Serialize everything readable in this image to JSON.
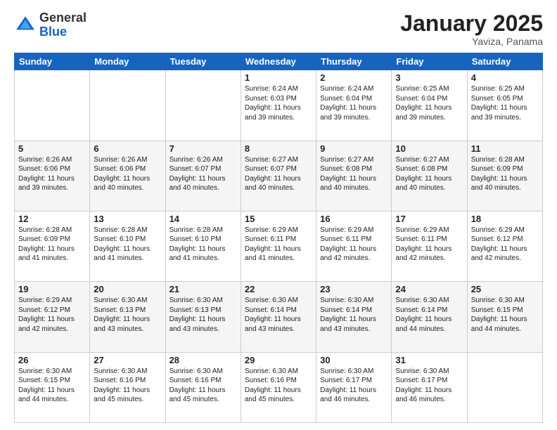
{
  "logo": {
    "general": "General",
    "blue": "Blue"
  },
  "header": {
    "month": "January 2025",
    "location": "Yaviza, Panama"
  },
  "days_of_week": [
    "Sunday",
    "Monday",
    "Tuesday",
    "Wednesday",
    "Thursday",
    "Friday",
    "Saturday"
  ],
  "weeks": [
    [
      {
        "day": "",
        "info": ""
      },
      {
        "day": "",
        "info": ""
      },
      {
        "day": "",
        "info": ""
      },
      {
        "day": "1",
        "info": "Sunrise: 6:24 AM\nSunset: 6:03 PM\nDaylight: 11 hours and 39 minutes."
      },
      {
        "day": "2",
        "info": "Sunrise: 6:24 AM\nSunset: 6:04 PM\nDaylight: 11 hours and 39 minutes."
      },
      {
        "day": "3",
        "info": "Sunrise: 6:25 AM\nSunset: 6:04 PM\nDaylight: 11 hours and 39 minutes."
      },
      {
        "day": "4",
        "info": "Sunrise: 6:25 AM\nSunset: 6:05 PM\nDaylight: 11 hours and 39 minutes."
      }
    ],
    [
      {
        "day": "5",
        "info": "Sunrise: 6:26 AM\nSunset: 6:06 PM\nDaylight: 11 hours and 39 minutes."
      },
      {
        "day": "6",
        "info": "Sunrise: 6:26 AM\nSunset: 6:06 PM\nDaylight: 11 hours and 40 minutes."
      },
      {
        "day": "7",
        "info": "Sunrise: 6:26 AM\nSunset: 6:07 PM\nDaylight: 11 hours and 40 minutes."
      },
      {
        "day": "8",
        "info": "Sunrise: 6:27 AM\nSunset: 6:07 PM\nDaylight: 11 hours and 40 minutes."
      },
      {
        "day": "9",
        "info": "Sunrise: 6:27 AM\nSunset: 6:08 PM\nDaylight: 11 hours and 40 minutes."
      },
      {
        "day": "10",
        "info": "Sunrise: 6:27 AM\nSunset: 6:08 PM\nDaylight: 11 hours and 40 minutes."
      },
      {
        "day": "11",
        "info": "Sunrise: 6:28 AM\nSunset: 6:09 PM\nDaylight: 11 hours and 40 minutes."
      }
    ],
    [
      {
        "day": "12",
        "info": "Sunrise: 6:28 AM\nSunset: 6:09 PM\nDaylight: 11 hours and 41 minutes."
      },
      {
        "day": "13",
        "info": "Sunrise: 6:28 AM\nSunset: 6:10 PM\nDaylight: 11 hours and 41 minutes."
      },
      {
        "day": "14",
        "info": "Sunrise: 6:28 AM\nSunset: 6:10 PM\nDaylight: 11 hours and 41 minutes."
      },
      {
        "day": "15",
        "info": "Sunrise: 6:29 AM\nSunset: 6:11 PM\nDaylight: 11 hours and 41 minutes."
      },
      {
        "day": "16",
        "info": "Sunrise: 6:29 AM\nSunset: 6:11 PM\nDaylight: 11 hours and 42 minutes."
      },
      {
        "day": "17",
        "info": "Sunrise: 6:29 AM\nSunset: 6:11 PM\nDaylight: 11 hours and 42 minutes."
      },
      {
        "day": "18",
        "info": "Sunrise: 6:29 AM\nSunset: 6:12 PM\nDaylight: 11 hours and 42 minutes."
      }
    ],
    [
      {
        "day": "19",
        "info": "Sunrise: 6:29 AM\nSunset: 6:12 PM\nDaylight: 11 hours and 42 minutes."
      },
      {
        "day": "20",
        "info": "Sunrise: 6:30 AM\nSunset: 6:13 PM\nDaylight: 11 hours and 43 minutes."
      },
      {
        "day": "21",
        "info": "Sunrise: 6:30 AM\nSunset: 6:13 PM\nDaylight: 11 hours and 43 minutes."
      },
      {
        "day": "22",
        "info": "Sunrise: 6:30 AM\nSunset: 6:14 PM\nDaylight: 11 hours and 43 minutes."
      },
      {
        "day": "23",
        "info": "Sunrise: 6:30 AM\nSunset: 6:14 PM\nDaylight: 11 hours and 43 minutes."
      },
      {
        "day": "24",
        "info": "Sunrise: 6:30 AM\nSunset: 6:14 PM\nDaylight: 11 hours and 44 minutes."
      },
      {
        "day": "25",
        "info": "Sunrise: 6:30 AM\nSunset: 6:15 PM\nDaylight: 11 hours and 44 minutes."
      }
    ],
    [
      {
        "day": "26",
        "info": "Sunrise: 6:30 AM\nSunset: 6:15 PM\nDaylight: 11 hours and 44 minutes."
      },
      {
        "day": "27",
        "info": "Sunrise: 6:30 AM\nSunset: 6:16 PM\nDaylight: 11 hours and 45 minutes."
      },
      {
        "day": "28",
        "info": "Sunrise: 6:30 AM\nSunset: 6:16 PM\nDaylight: 11 hours and 45 minutes."
      },
      {
        "day": "29",
        "info": "Sunrise: 6:30 AM\nSunset: 6:16 PM\nDaylight: 11 hours and 45 minutes."
      },
      {
        "day": "30",
        "info": "Sunrise: 6:30 AM\nSunset: 6:17 PM\nDaylight: 11 hours and 46 minutes."
      },
      {
        "day": "31",
        "info": "Sunrise: 6:30 AM\nSunset: 6:17 PM\nDaylight: 11 hours and 46 minutes."
      },
      {
        "day": "",
        "info": ""
      }
    ]
  ]
}
